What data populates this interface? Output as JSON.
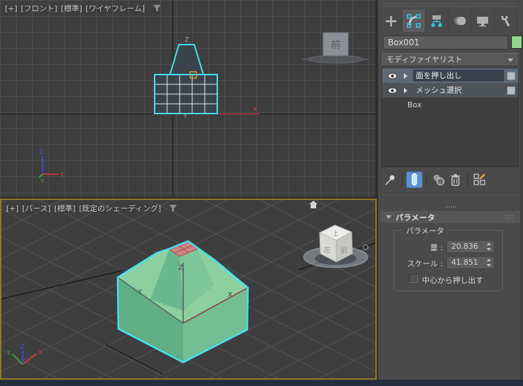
{
  "colors": {
    "viewport_bg": "#3e3e3e",
    "grid_line": "#4f4f4f",
    "selection_cyan": "#46e2f2",
    "active_viewport_border": "#8f7c2c",
    "panel_bg": "#4a4a4a",
    "accent_blue": "#5b8fd0",
    "object_green_top": "#8cd0a0",
    "object_green_left": "#5fae84",
    "object_green_right": "#74bf92",
    "selected_face_red": "#cf8282",
    "object_color_swatch": "#90d98a",
    "gizmo_orange": "#d69a3c",
    "axis_red": "#c03838",
    "axis_green": "#3aa03a",
    "axis_blue": "#3b4bd8",
    "bottom_bar": "#262d3d"
  },
  "viewport_front": {
    "labels": [
      "[+]",
      "[フロント]",
      "[標準]",
      "[ワイヤフレーム]"
    ],
    "axis": {
      "x": "X",
      "y": "Y",
      "z": "Z"
    },
    "viewcube": {
      "front": "前"
    }
  },
  "viewport_persp": {
    "labels": [
      "[+]",
      "[パース]",
      "[標準]",
      "[既定のシェーディング]"
    ],
    "axis": {
      "x": "X",
      "y": "Y",
      "z": "Z"
    },
    "viewcube": {
      "top": "上",
      "left": "左",
      "front": "前"
    }
  },
  "command_panel": {
    "tabs": [
      {
        "name": "create"
      },
      {
        "name": "modify",
        "selected": true
      },
      {
        "name": "hierarchy"
      },
      {
        "name": "motion"
      },
      {
        "name": "display"
      },
      {
        "name": "utilities"
      }
    ],
    "object_name": "Box001",
    "modifier_list_label": "モディファイヤリスト",
    "stack": [
      {
        "label": "面を押し出し",
        "selected": true
      },
      {
        "label": "メッシュ選択",
        "selected": false
      },
      {
        "label": "Box",
        "base": true
      }
    ],
    "parameters": {
      "rollout_title": "パラメータ",
      "group_title": "パラメータ",
      "amount_label": "量 :",
      "amount_value": "20.836",
      "scale_label": "スケール :",
      "scale_value": "41.851",
      "checkbox_label": "中心から押し出す"
    }
  }
}
